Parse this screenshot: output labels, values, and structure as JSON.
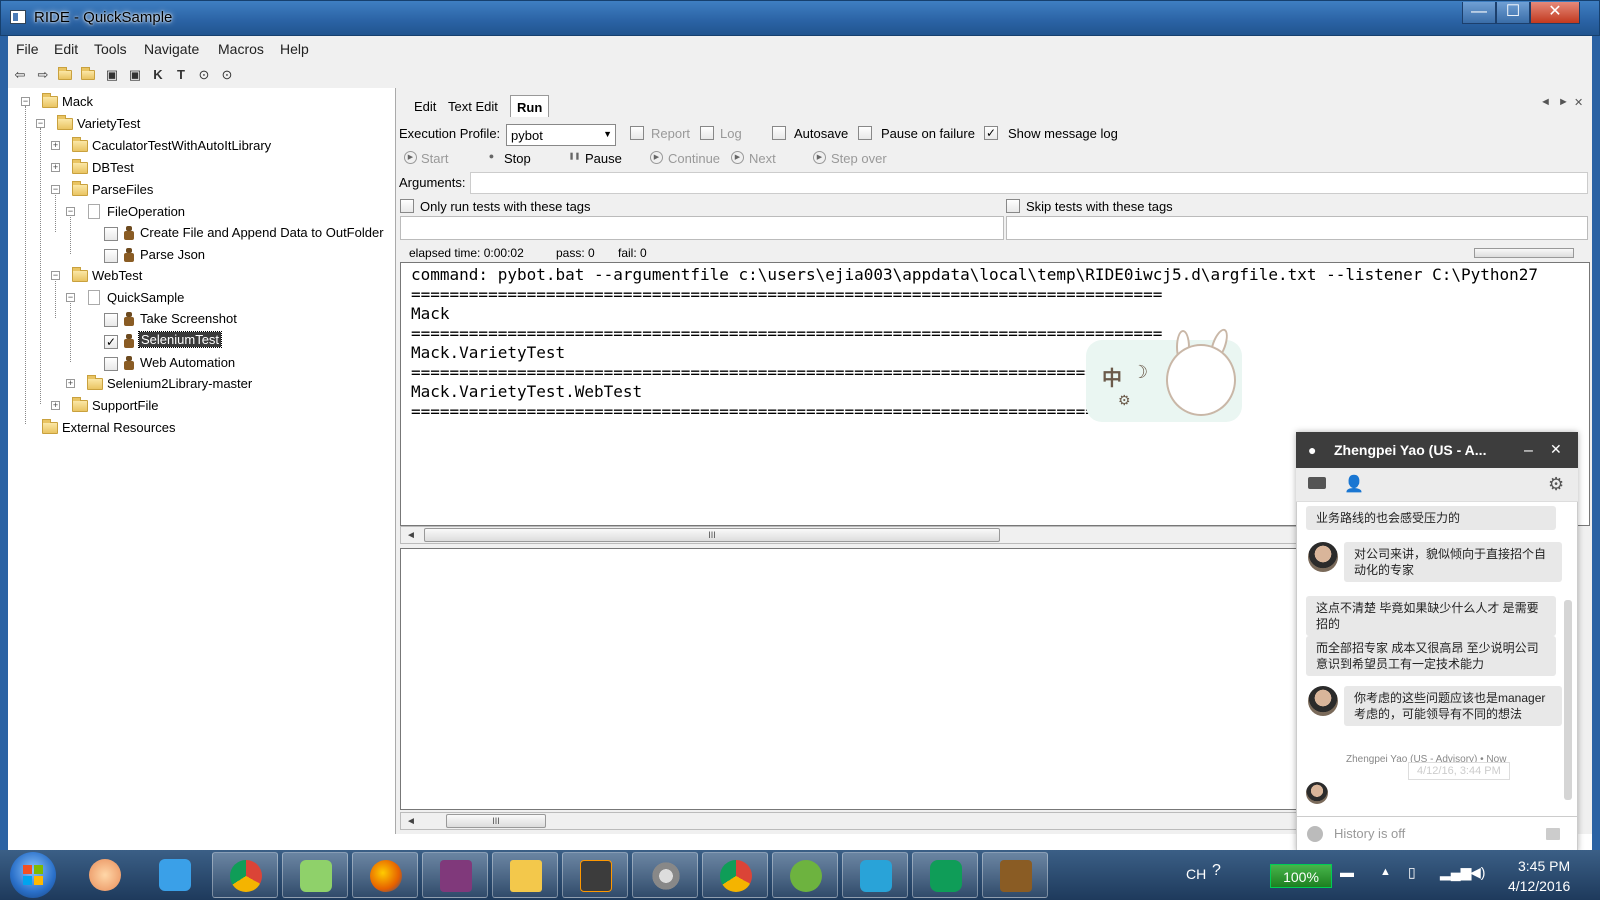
{
  "window": {
    "title": "RIDE - QuickSample",
    "min": "—",
    "max": "☐",
    "close": "✕"
  },
  "menu": [
    "File",
    "Edit",
    "Tools",
    "Navigate",
    "Macros",
    "Help"
  ],
  "toolbar_icons": [
    "back-icon",
    "forward-icon",
    "open-suite-icon",
    "open-directory-icon",
    "save-icon",
    "save-all-icon",
    "search-keywords-icon",
    "search-tests-icon",
    "run-icon",
    "stop-icon"
  ],
  "toolbar_glyphs": {
    "k": "K",
    "t": "T"
  },
  "tree": {
    "root": "Mack",
    "variety": "VarietyTest",
    "calc": "CaculatorTestWithAutoItLibrary",
    "db": "DBTest",
    "parse": "ParseFiles",
    "fileop": "FileOperation",
    "create": "Create File and Append Data to OutFolder",
    "json": "Parse Json",
    "web": "WebTest",
    "quick": "QuickSample",
    "shot": "Take Screenshot",
    "selenium": "SeleniumTest",
    "webauto": "Web Automation",
    "sel2": "Selenium2Library-master",
    "support": "SupportFile",
    "ext": "External Resources"
  },
  "tabs": {
    "edit": "Edit",
    "text": "Text Edit",
    "run": "Run"
  },
  "tab_nav": {
    "left": "◄",
    "right": "►",
    "close": "✕"
  },
  "run": {
    "profile_label": "Execution Profile:",
    "profile_value": "pybot",
    "report": "Report",
    "log": "Log",
    "autosave": "Autosave",
    "pause_fail": "Pause on failure",
    "show_log": "Show message log",
    "start": "Start",
    "stop": "Stop",
    "pause": "Pause",
    "continue": "Continue",
    "next": "Next",
    "stepover": "Step over",
    "arguments": "Arguments:",
    "only_tags": "Only run tests with these tags",
    "skip_tags": "Skip tests with these tags",
    "elapsed": "elapsed time: 0:00:02",
    "pass": "pass: 0",
    "fail": "fail: 0"
  },
  "console": [
    "command: pybot.bat --argumentfile c:\\users\\ejia003\\appdata\\local\\temp\\RIDE0iwcj5.d\\argfile.txt --listener C:\\Python27",
    "==============================================================================",
    "Mack",
    "==============================================================================",
    "Mack.VarietyTest",
    "==============================================================================",
    "Mack.VarietyTest.WebTest",
    "=============================================================================="
  ],
  "scroll_grip": "III",
  "sticker": {
    "zh": "中",
    "moon": "☽"
  },
  "chat": {
    "name": "Zhengpei Yao (US - A...",
    "msg0": "业务路线的也会感受压力的",
    "msg1": "对公司来讲，貌似倾向于直接招个自动化的专家",
    "msg2a": "这点不清楚 毕竟如果缺少什么人才 是需要招的",
    "msg2b": "而全部招专家 成本又很高昂 至少说明公司意识到希望员工有一定技术能力",
    "msg3": "你考虑的这些问题应该也是manager考虑的，可能领导有不同的想法",
    "meta": "Zhengpei Yao (US - Advisory) • Now",
    "tooltip": "4/12/16, 3:44 PM",
    "input_placeholder": "History is off"
  },
  "taskbar": {
    "apps": [
      "windows-explorer-flower-icon",
      "qq-icon",
      "chrome-icon",
      "keyboard-cloud-icon",
      "firefox-icon",
      "onenote-icon",
      "file-explorer-icon",
      "sublime-icon",
      "settings-icon",
      "chrome-canary-icon",
      "spring-icon",
      "network-icon",
      "hangouts-icon",
      "robot-icon"
    ],
    "lang": "CH",
    "battery": "100%",
    "time": "3:45 PM",
    "date": "4/12/2016"
  }
}
